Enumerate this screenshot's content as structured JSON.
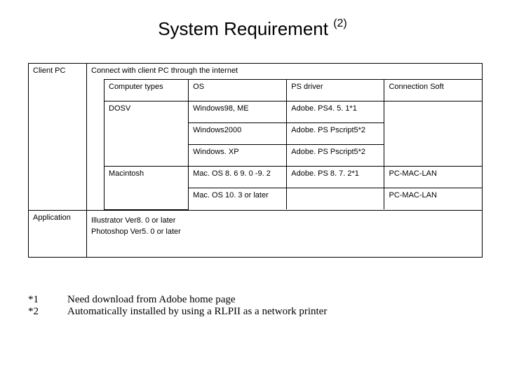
{
  "title_main": "System Requirement ",
  "title_sup": "(2)",
  "side": {
    "client_pc": "Client PC",
    "application": "Application"
  },
  "connect_caption": "Connect with client PC through the internet",
  "inner": {
    "header": {
      "computer_types": "Computer types",
      "os": "OS",
      "ps_driver": "PS driver",
      "connection_soft": "Connection Soft"
    },
    "rows": {
      "r1": {
        "ct": "DOSV",
        "os": "Windows98, ME",
        "ps": "Adobe. PS4. 5. 1*1",
        "cs": ""
      },
      "r2": {
        "ct": "",
        "os": "Windows2000",
        "ps": "Adobe. PS Pscript5*2",
        "cs": ""
      },
      "r3": {
        "ct": "",
        "os": "Windows. XP",
        "ps": "Adobe. PS Pscript5*2",
        "cs": ""
      },
      "r4": {
        "ct": "Macintosh",
        "os": "Mac. OS  8. 6 9. 0 -9. 2",
        "ps": "Adobe. PS  8. 7. 2*1",
        "cs": "PC-MAC-LAN"
      },
      "r5": {
        "ct": "",
        "os": "Mac. OS 10. 3 or later",
        "ps": "",
        "cs": "PC-MAC-LAN"
      }
    }
  },
  "apps": {
    "line1": "Illustrator Ver8. 0 or later",
    "line2": "Photoshop Ver5. 0 or later"
  },
  "notes": {
    "n1_label": "*1",
    "n1_text": "Need download from Adobe home page",
    "n2_label": "*2",
    "n2_text": "Automatically installed by using a RLPII as a network printer"
  },
  "chart_data": {
    "type": "table",
    "title": "System Requirement (2)",
    "columns": [
      "Computer types",
      "OS",
      "PS driver",
      "Connection Soft"
    ],
    "rows": [
      [
        "DOSV",
        "Windows98, ME",
        "Adobe.PS 4.5.1 *1",
        ""
      ],
      [
        "DOSV",
        "Windows2000",
        "Adobe.PS Pscript5 *2",
        ""
      ],
      [
        "DOSV",
        "Windows.XP",
        "Adobe.PS Pscript5 *2",
        ""
      ],
      [
        "Macintosh",
        "Mac.OS 8.6 9.0-9.2",
        "Adobe.PS 8.7.2 *1",
        "PC-MAC-LAN"
      ],
      [
        "Macintosh",
        "Mac.OS 10.3 or later",
        "",
        "PC-MAC-LAN"
      ]
    ],
    "context": {
      "Client PC": "Connect with client PC through the internet",
      "Application": [
        "Illustrator Ver8.0 or later",
        "Photoshop Ver5.0 or later"
      ]
    },
    "footnotes": {
      "*1": "Need download from Adobe home page",
      "*2": "Automatically installed by using a RLPII as a network printer"
    }
  }
}
